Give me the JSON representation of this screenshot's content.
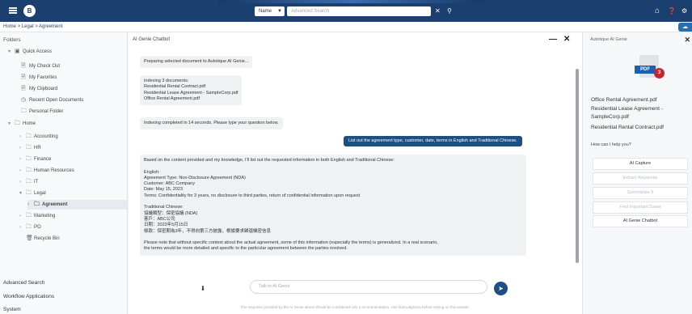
{
  "topbar": {
    "logo_letter": "B",
    "scope_value": "Name",
    "search_placeholder": "Advanced Search",
    "icons": [
      "home-icon",
      "help-icon",
      "settings-icon"
    ]
  },
  "breadcrumb": {
    "text": "Home  >  Legal  >  Agreement"
  },
  "sidebar": {
    "title": "Folders",
    "items": [
      {
        "label": "Quick Access",
        "toggle": "▾",
        "icon": "▣"
      },
      {
        "label": "My Check Out",
        "toggle": "",
        "icon": "🗎"
      },
      {
        "label": "My Favorites",
        "toggle": "",
        "icon": "🗎"
      },
      {
        "label": "My Clipboard",
        "toggle": "",
        "icon": "🗎"
      },
      {
        "label": "Recent Open Documents",
        "toggle": "",
        "icon": "◷"
      },
      {
        "label": "Personal Folder",
        "toggle": "",
        "icon": "🗀"
      },
      {
        "label": "Home",
        "toggle": "▾",
        "icon": "🗀"
      },
      {
        "label": "Accounting",
        "toggle": "›",
        "icon": "🗀"
      },
      {
        "label": "HR",
        "toggle": "›",
        "icon": "🗀"
      },
      {
        "label": "Finance",
        "toggle": "›",
        "icon": "🗀"
      },
      {
        "label": "Human Resources",
        "toggle": "›",
        "icon": "🗀"
      },
      {
        "label": "IT",
        "toggle": "›",
        "icon": "🗀"
      },
      {
        "label": "Legal",
        "toggle": "▾",
        "icon": "🗀"
      },
      {
        "label": "Agreement",
        "toggle": "›",
        "icon": "🗀"
      },
      {
        "label": "Marketing",
        "toggle": "›",
        "icon": "🗀"
      },
      {
        "label": "PO",
        "toggle": "›",
        "icon": "🗀"
      },
      {
        "label": "Recycle Bin",
        "toggle": "",
        "icon": "🗑"
      }
    ],
    "footer": [
      "Advanced Search",
      "Workflow Applications",
      "System"
    ]
  },
  "chat": {
    "title": "AI Genie Chatbot",
    "minimize": "—",
    "close": "✕",
    "msg_preparing": "Preparing selected document to Autotique AI Genie...",
    "msg_indexing": [
      "Indexing 3 documents:",
      "Residential Rental Contract.pdf",
      "Residential Lease Agreement - SampleCorp.pdf",
      "Office Rental Agreement.pdf"
    ],
    "msg_indexed": "Indexing completed in 14 seconds. Please type your question below.",
    "msg_user": "List out the agreement type, customer, date, terms in English and Traditional Chinese.",
    "msg_answer": [
      "Based on the content provided and my knowledge, I'll list out the requested information in both English and Traditional Chinese:",
      "",
      "English:",
      "Agreement Type: Non-Disclosure Agreement (NDA)",
      "Customer: ABC Company",
      "Date: May 15, 2023",
      "Terms: Confidentiality for 3 years, no disclosure to third parties, return of confidential information upon request",
      "",
      "Traditional Chinese:",
      "協議類型：保密協議 (NDA)",
      "客戶：ABC公司",
      "日期：2023年5月15日",
      "條款：保密期為3年，不得向第三方披露，根據要求歸還機密信息",
      "",
      "Please note that without specific context about the actual agreement, some of this information (especially the terms) is generalized. In a real scenario,",
      "the terms would be more detailed and specific to the particular agreement between the parties involved."
    ],
    "input_placeholder": "Talk to AI Genie",
    "disclaimer": "The response provided by the AI Genie above should be considered only a recommendation. Use final judgment before relying on this answer."
  },
  "right_panel": {
    "title": "Autotique AI Genie",
    "close": "✕",
    "pdf_label": "PDF",
    "pdf_count": "3",
    "documents": [
      "Office Rental Agreement.pdf",
      "Residential Lease Agreement -",
      "SampleCorp.pdf",
      "Residential Rental Contract.pdf"
    ],
    "help_question": "How can I help you?",
    "actions": [
      "AI Capture",
      "Extract Keywords",
      "Summarize It",
      "Find Important Dates",
      "AI Genie Chatbot"
    ],
    "colors": {
      "accent": "#1d4f85",
      "topbar": "#1b3f6e",
      "badge": "#c8252c"
    }
  }
}
